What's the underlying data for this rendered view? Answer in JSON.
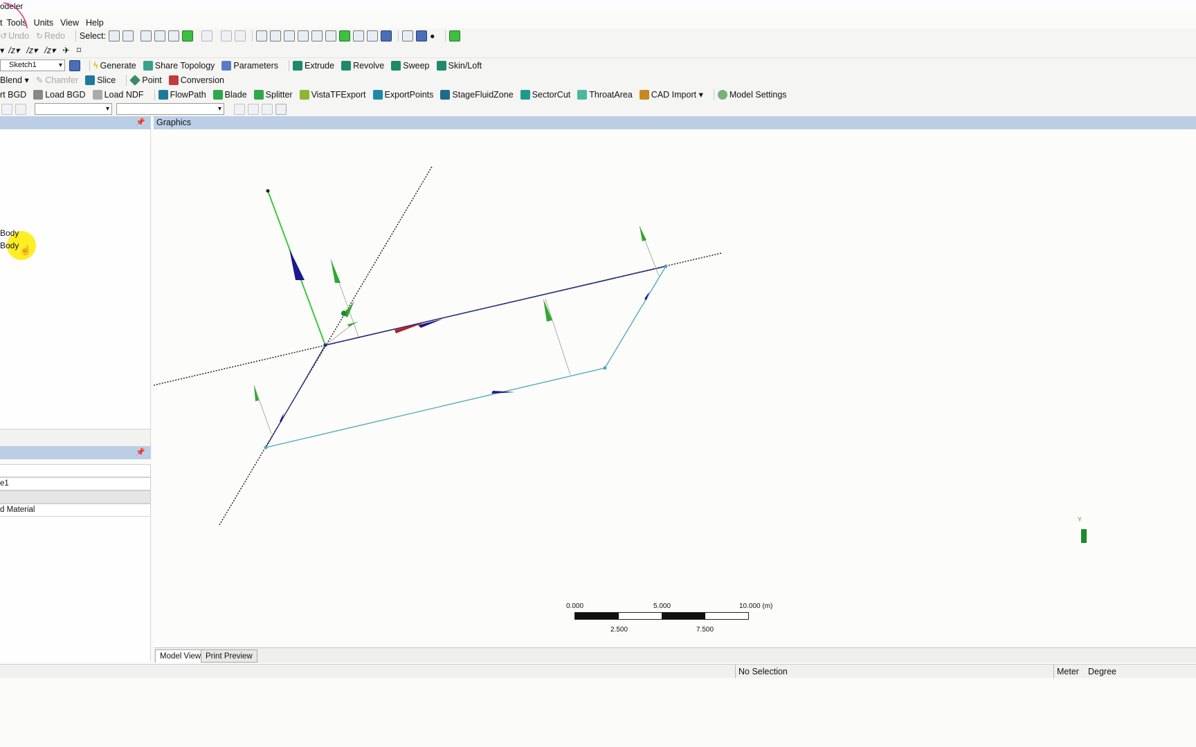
{
  "app": {
    "title": "odeler"
  },
  "menu": [
    "t",
    "Tools",
    "Units",
    "View",
    "Help"
  ],
  "toolbar1": {
    "undo": "Undo",
    "redo": "Redo",
    "select": "Select:"
  },
  "toolbar3": {
    "sketch_combo": "Sketch1",
    "generate": "Generate",
    "share_topology": "Share Topology",
    "parameters": "Parameters",
    "extrude": "Extrude",
    "revolve": "Revolve",
    "sweep": "Sweep",
    "skin_loft": "Skin/Loft"
  },
  "toolbar4": {
    "blend": "Blend",
    "chamfer": "Chamfer",
    "slice": "Slice",
    "point": "Point",
    "conversion": "Conversion"
  },
  "toolbar5": {
    "export_bgd": "rt BGD",
    "load_bgd": "Load BGD",
    "load_ndf": "Load NDF",
    "flowpath": "FlowPath",
    "blade": "Blade",
    "splitter": "Splitter",
    "vistatfexport": "VistaTFExport",
    "exportpoints": "ExportPoints",
    "stagefluidzone": "StageFluidZone",
    "sectorcut": "SectorCut",
    "throatarea": "ThroatArea",
    "cad_import": "CAD Import",
    "model_settings": "Model Settings"
  },
  "tree": {
    "items": [
      "Body",
      "Body"
    ]
  },
  "details": {
    "row1": "e1",
    "row3": "d Material"
  },
  "graphics": {
    "title": "Graphics"
  },
  "scale": {
    "top": [
      "0.000",
      "5.000",
      "10.000 (m)"
    ],
    "bottom": [
      "2.500",
      "7.500"
    ]
  },
  "axis_label": "Y",
  "tabs": {
    "model_view": "Model View",
    "print_preview": "Print Preview"
  },
  "status": {
    "selection": "No Selection",
    "length_unit": "Meter",
    "angle_unit": "Degree"
  }
}
